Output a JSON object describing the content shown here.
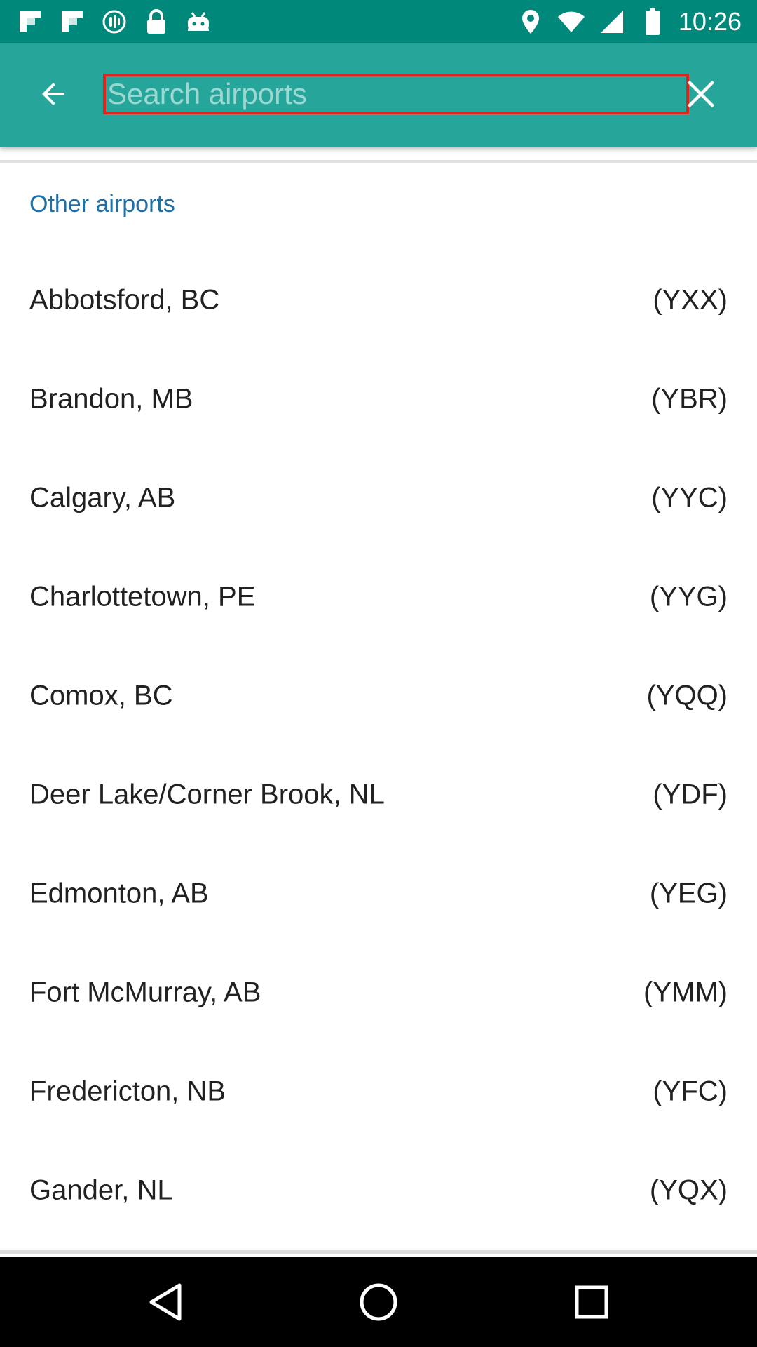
{
  "status_bar": {
    "time": "10:26",
    "left_icons": [
      "flipboard-icon",
      "flipboard-icon",
      "google-assistant-icon",
      "lock-icon",
      "android-icon"
    ],
    "right_icons": [
      "location-pin-icon",
      "wifi-icon",
      "signal-icon",
      "battery-icon"
    ],
    "background": "#00897b"
  },
  "app_bar": {
    "background": "#26a69a",
    "back_icon": "arrow-back-icon",
    "search": {
      "value": "",
      "placeholder": "Search airports"
    },
    "clear_icon": "close-icon"
  },
  "section": {
    "header": "Other airports",
    "header_color": "#1f6fa8"
  },
  "airports": [
    {
      "name": "Abbotsford, BC",
      "code": "(YXX)"
    },
    {
      "name": "Brandon, MB",
      "code": "(YBR)"
    },
    {
      "name": "Calgary, AB",
      "code": "(YYC)"
    },
    {
      "name": "Charlottetown, PE",
      "code": "(YYG)"
    },
    {
      "name": "Comox, BC",
      "code": "(YQQ)"
    },
    {
      "name": "Deer Lake/Corner Brook, NL",
      "code": "(YDF)"
    },
    {
      "name": "Edmonton, AB",
      "code": "(YEG)"
    },
    {
      "name": "Fort McMurray, AB",
      "code": "(YMM)"
    },
    {
      "name": "Fredericton, NB",
      "code": "(YFC)"
    },
    {
      "name": "Gander, NL",
      "code": "(YQX)"
    }
  ],
  "nav_bar": {
    "buttons": [
      "back-triangle-icon",
      "home-circle-icon",
      "recents-square-icon"
    ]
  }
}
